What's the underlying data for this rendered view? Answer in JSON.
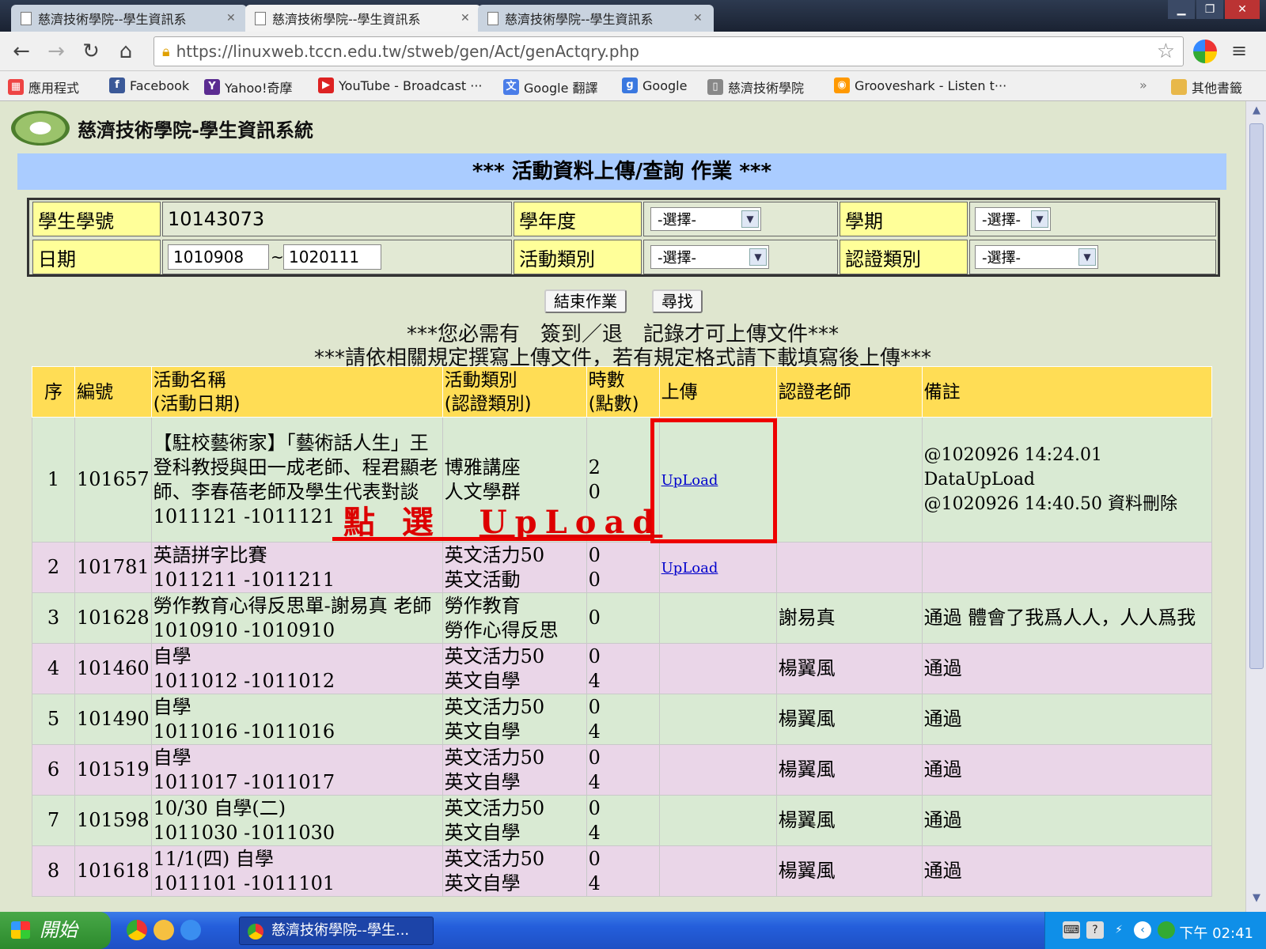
{
  "browser": {
    "tabs": [
      {
        "title": "慈濟技術學院--學生資訊系"
      },
      {
        "title": "慈濟技術學院--學生資訊系"
      },
      {
        "title": "慈濟技術學院--學生資訊系"
      }
    ],
    "url": "https://linuxweb.tccn.edu.tw/stweb/gen/Act/genActqry.php",
    "bookmarks": [
      {
        "label": "應用程式",
        "icon": "apps-grid-icon",
        "color": "#e44"
      },
      {
        "label": "Facebook",
        "icon": "facebook-icon",
        "color": "#3b5998"
      },
      {
        "label": "Yahoo!奇摩",
        "icon": "yahoo-icon",
        "color": "#5b2c91"
      },
      {
        "label": "YouTube - Broadcast ···",
        "icon": "youtube-icon",
        "color": "#d22"
      },
      {
        "label": "Google 翻譯",
        "icon": "google-translate-icon",
        "color": "#4a7de8"
      },
      {
        "label": "Google",
        "icon": "google-icon",
        "color": "#3a78e0"
      },
      {
        "label": "慈濟技術學院",
        "icon": "page-icon",
        "color": "#888"
      },
      {
        "label": "Grooveshark - Listen t···",
        "icon": "grooveshark-icon",
        "color": "#f90"
      }
    ],
    "bookmarks_overflow": "»",
    "other_bookmarks": "其他書籤"
  },
  "site": {
    "title": "慈濟技術學院-學生資訊系統",
    "banner": "*** 活動資料上傳/查詢 作業 ***"
  },
  "form": {
    "student_id_label": "學生學號",
    "student_id_value": "10143073",
    "year_label": "學年度",
    "year_select": "-選擇-",
    "term_label": "學期",
    "term_select": "-選擇-",
    "date_label": "日期",
    "date_from": "1010908",
    "date_sep": "~",
    "date_to": "1020111",
    "activity_type_label": "活動類別",
    "activity_type_select": "-選擇-",
    "cert_type_label": "認證類別",
    "cert_type_select": "-選擇-",
    "end_button": "結束作業",
    "search_button": "尋找"
  },
  "notices": {
    "line1": "***您必需有　簽到／退　記錄才可上傳文件***",
    "line2": "***請依相關規定撰寫上傳文件，若有規定格式請下載填寫後上傳***"
  },
  "table": {
    "headers": {
      "seq": "序",
      "id": "編號",
      "name": "活動名稱",
      "name_sub": "(活動日期)",
      "type": "活動類別",
      "type_sub": "(認證類別)",
      "hours": "時數",
      "hours_sub": "(點數)",
      "upload": "上傳",
      "teacher": "認證老師",
      "note": "備註"
    },
    "rows": [
      {
        "seq": "1",
        "id": "101657",
        "name": "【駐校藝術家】「藝術話人生」王登科教授與田一成老師、程君顯老師、李春蓓老師及學生代表對談",
        "date": "1011121 -1011121",
        "type": "博雅講座",
        "cert": "人文學群",
        "hours": "2",
        "points": "0",
        "upload": "UpLoad",
        "teacher": "",
        "note1": "@1020926 14:24.01 DataUpLoad",
        "note2": "@1020926 14:40.50 資料刪除"
      },
      {
        "seq": "2",
        "id": "101781",
        "name": "英語拼字比賽",
        "date": "1011211 -1011211",
        "type": "英文活力50",
        "cert": "英文活動",
        "hours": "0",
        "points": "0",
        "upload": "UpLoad",
        "teacher": "",
        "note1": "",
        "note2": ""
      },
      {
        "seq": "3",
        "id": "101628",
        "name": "勞作教育心得反思單-謝易真 老師",
        "date": "1010910 -1010910",
        "type": "勞作教育",
        "cert": "勞作心得反思",
        "hours": "",
        "points": "0",
        "upload": "",
        "teacher": "謝易真",
        "note1": "通過 體會了我爲人人，人人爲我",
        "note2": ""
      },
      {
        "seq": "4",
        "id": "101460",
        "name": "自學",
        "date": "1011012 -1011012",
        "type": "英文活力50",
        "cert": "英文自學",
        "hours": "0",
        "points": "4",
        "upload": "",
        "teacher": "楊翼風",
        "note1": "通過",
        "note2": ""
      },
      {
        "seq": "5",
        "id": "101490",
        "name": "自學",
        "date": "1011016 -1011016",
        "type": "英文活力50",
        "cert": "英文自學",
        "hours": "0",
        "points": "4",
        "upload": "",
        "teacher": "楊翼風",
        "note1": "通過",
        "note2": ""
      },
      {
        "seq": "6",
        "id": "101519",
        "name": "自學",
        "date": "1011017 -1011017",
        "type": "英文活力50",
        "cert": "英文自學",
        "hours": "0",
        "points": "4",
        "upload": "",
        "teacher": "楊翼風",
        "note1": "通過",
        "note2": ""
      },
      {
        "seq": "7",
        "id": "101598",
        "name": "10/30 自學(二)",
        "date": "1011030 -1011030",
        "type": "英文活力50",
        "cert": "英文自學",
        "hours": "0",
        "points": "4",
        "upload": "",
        "teacher": "楊翼風",
        "note1": "通過",
        "note2": ""
      },
      {
        "seq": "8",
        "id": "101618",
        "name": "11/1(四) 自學",
        "date": "1011101 -1011101",
        "type": "英文活力50",
        "cert": "英文自學",
        "hours": "0",
        "points": "4",
        "upload": "",
        "teacher": "楊翼風",
        "note1": "通過",
        "note2": ""
      }
    ]
  },
  "annotation": {
    "text_a": "點 選",
    "text_b": "UpLoad",
    "color": "#ee0000"
  },
  "taskbar": {
    "start": "開始",
    "task_item": "慈濟技術學院--學生...",
    "clock": "下午 02:41"
  }
}
